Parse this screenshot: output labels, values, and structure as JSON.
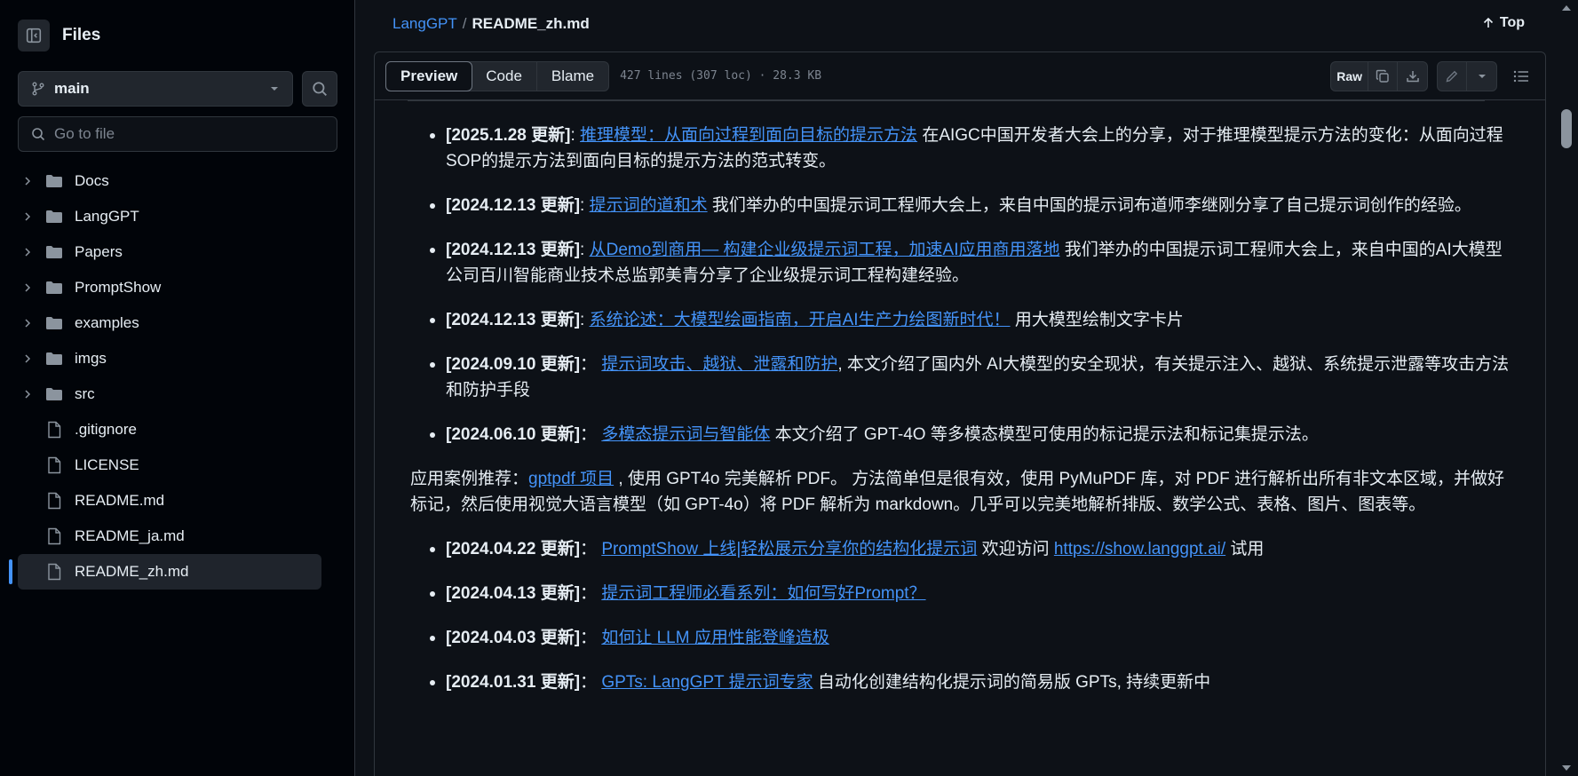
{
  "sidebar": {
    "title": "Files",
    "branch": "main",
    "goto_placeholder": "Go to file",
    "tree": [
      {
        "type": "folder",
        "name": "Docs"
      },
      {
        "type": "folder",
        "name": "LangGPT"
      },
      {
        "type": "folder",
        "name": "Papers"
      },
      {
        "type": "folder",
        "name": "PromptShow"
      },
      {
        "type": "folder",
        "name": "examples"
      },
      {
        "type": "folder",
        "name": "imgs"
      },
      {
        "type": "folder",
        "name": "src"
      },
      {
        "type": "file",
        "name": ".gitignore"
      },
      {
        "type": "file",
        "name": "LICENSE"
      },
      {
        "type": "file",
        "name": "README.md"
      },
      {
        "type": "file",
        "name": "README_ja.md"
      },
      {
        "type": "file",
        "name": "README_zh.md",
        "active": true
      }
    ]
  },
  "header": {
    "repo": "LangGPT",
    "sep": "/",
    "file": "README_zh.md",
    "top_label": "Top"
  },
  "toolbar": {
    "tabs": [
      "Preview",
      "Code",
      "Blame"
    ],
    "active_tab": "Preview",
    "meta": "427 lines (307 loc) · 28.3 KB",
    "raw_label": "Raw"
  },
  "readme": {
    "news1": [
      {
        "date": "[2025.1.28 更新]",
        "sep": ": ",
        "link": "推理模型：从面向过程到面向目标的提示方法",
        "text": " 在AIGC中国开发者大会上的分享，对于推理模型提示方法的变化：从面向过程SOP的提示方法到面向目标的提示方法的范式转变。"
      },
      {
        "date": "[2024.12.13 更新]",
        "sep": ": ",
        "link": "提示词的道和术",
        "text": " 我们举办的中国提示词工程师大会上，来自中国的提示词布道师李继刚分享了自己提示词创作的经验。"
      },
      {
        "date": "[2024.12.13 更新]",
        "sep": ": ",
        "link": "从Demo到商用— 构建企业级提示词工程，加速AI应用商用落地",
        "text": " 我们举办的中国提示词工程师大会上，来自中国的AI大模型公司百川智能商业技术总监郭美青分享了企业级提示词工程构建经验。"
      },
      {
        "date": "[2024.12.13 更新]",
        "sep": ": ",
        "link": "系统论述：大模型绘画指南，开启AI生产力绘图新时代！",
        "text": " 用大模型绘制文字卡片"
      },
      {
        "date": "[2024.09.10 更新]",
        "sep": "： ",
        "link": "提示词攻击、越狱、泄露和防护",
        "text": ", 本文介绍了国内外 AI大模型的安全现状，有关提示注入、越狱、系统提示泄露等攻击方法和防护手段"
      },
      {
        "date": "[2024.06.10 更新]",
        "sep": "： ",
        "link": "多模态提示词与智能体",
        "text": " 本文介绍了 GPT-4O 等多模态模型可使用的标记提示法和标记集提示法。"
      }
    ],
    "para_prefix": "应用案例推荐：",
    "para_link": "gptpdf 项目",
    "para_text": " , 使用 GPT4o 完美解析 PDF。 方法简单但是很有效，使用 PyMuPDF 库，对 PDF 进行解析出所有非文本区域，并做好标记，然后使用视觉大语言模型（如 GPT-4o）将 PDF 解析为 markdown。几乎可以完美地解析排版、数学公式、表格、图片、图表等。",
    "news2": [
      {
        "date": "[2024.04.22 更新]",
        "sep": "： ",
        "link": "PromptShow 上线|轻松展示分享你的结构化提示词",
        "text": " 欢迎访问 ",
        "link2": "https://show.langgpt.ai/",
        "text2": " 试用"
      },
      {
        "date": "[2024.04.13 更新]",
        "sep": "： ",
        "link": "提示词工程师必看系列：如何写好Prompt？",
        "text": ""
      },
      {
        "date": "[2024.04.03 更新]",
        "sep": "： ",
        "link": "如何让 LLM 应用性能登峰造极",
        "text": ""
      },
      {
        "date": "[2024.01.31 更新]",
        "sep": "： ",
        "link": "GPTs: LangGPT 提示词专家",
        "text": " 自动化创建结构化提示词的简易版 GPTs, 持续更新中"
      }
    ]
  }
}
